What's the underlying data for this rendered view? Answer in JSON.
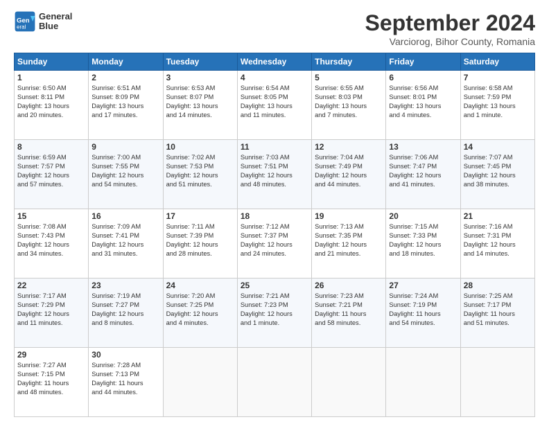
{
  "header": {
    "logo_line1": "General",
    "logo_line2": "Blue",
    "month_title": "September 2024",
    "location": "Varciorog, Bihor County, Romania"
  },
  "days_of_week": [
    "Sunday",
    "Monday",
    "Tuesday",
    "Wednesday",
    "Thursday",
    "Friday",
    "Saturday"
  ],
  "weeks": [
    [
      {
        "day": "1",
        "info": "Sunrise: 6:50 AM\nSunset: 8:11 PM\nDaylight: 13 hours\nand 20 minutes."
      },
      {
        "day": "2",
        "info": "Sunrise: 6:51 AM\nSunset: 8:09 PM\nDaylight: 13 hours\nand 17 minutes."
      },
      {
        "day": "3",
        "info": "Sunrise: 6:53 AM\nSunset: 8:07 PM\nDaylight: 13 hours\nand 14 minutes."
      },
      {
        "day": "4",
        "info": "Sunrise: 6:54 AM\nSunset: 8:05 PM\nDaylight: 13 hours\nand 11 minutes."
      },
      {
        "day": "5",
        "info": "Sunrise: 6:55 AM\nSunset: 8:03 PM\nDaylight: 13 hours\nand 7 minutes."
      },
      {
        "day": "6",
        "info": "Sunrise: 6:56 AM\nSunset: 8:01 PM\nDaylight: 13 hours\nand 4 minutes."
      },
      {
        "day": "7",
        "info": "Sunrise: 6:58 AM\nSunset: 7:59 PM\nDaylight: 13 hours\nand 1 minute."
      }
    ],
    [
      {
        "day": "8",
        "info": "Sunrise: 6:59 AM\nSunset: 7:57 PM\nDaylight: 12 hours\nand 57 minutes."
      },
      {
        "day": "9",
        "info": "Sunrise: 7:00 AM\nSunset: 7:55 PM\nDaylight: 12 hours\nand 54 minutes."
      },
      {
        "day": "10",
        "info": "Sunrise: 7:02 AM\nSunset: 7:53 PM\nDaylight: 12 hours\nand 51 minutes."
      },
      {
        "day": "11",
        "info": "Sunrise: 7:03 AM\nSunset: 7:51 PM\nDaylight: 12 hours\nand 48 minutes."
      },
      {
        "day": "12",
        "info": "Sunrise: 7:04 AM\nSunset: 7:49 PM\nDaylight: 12 hours\nand 44 minutes."
      },
      {
        "day": "13",
        "info": "Sunrise: 7:06 AM\nSunset: 7:47 PM\nDaylight: 12 hours\nand 41 minutes."
      },
      {
        "day": "14",
        "info": "Sunrise: 7:07 AM\nSunset: 7:45 PM\nDaylight: 12 hours\nand 38 minutes."
      }
    ],
    [
      {
        "day": "15",
        "info": "Sunrise: 7:08 AM\nSunset: 7:43 PM\nDaylight: 12 hours\nand 34 minutes."
      },
      {
        "day": "16",
        "info": "Sunrise: 7:09 AM\nSunset: 7:41 PM\nDaylight: 12 hours\nand 31 minutes."
      },
      {
        "day": "17",
        "info": "Sunrise: 7:11 AM\nSunset: 7:39 PM\nDaylight: 12 hours\nand 28 minutes."
      },
      {
        "day": "18",
        "info": "Sunrise: 7:12 AM\nSunset: 7:37 PM\nDaylight: 12 hours\nand 24 minutes."
      },
      {
        "day": "19",
        "info": "Sunrise: 7:13 AM\nSunset: 7:35 PM\nDaylight: 12 hours\nand 21 minutes."
      },
      {
        "day": "20",
        "info": "Sunrise: 7:15 AM\nSunset: 7:33 PM\nDaylight: 12 hours\nand 18 minutes."
      },
      {
        "day": "21",
        "info": "Sunrise: 7:16 AM\nSunset: 7:31 PM\nDaylight: 12 hours\nand 14 minutes."
      }
    ],
    [
      {
        "day": "22",
        "info": "Sunrise: 7:17 AM\nSunset: 7:29 PM\nDaylight: 12 hours\nand 11 minutes."
      },
      {
        "day": "23",
        "info": "Sunrise: 7:19 AM\nSunset: 7:27 PM\nDaylight: 12 hours\nand 8 minutes."
      },
      {
        "day": "24",
        "info": "Sunrise: 7:20 AM\nSunset: 7:25 PM\nDaylight: 12 hours\nand 4 minutes."
      },
      {
        "day": "25",
        "info": "Sunrise: 7:21 AM\nSunset: 7:23 PM\nDaylight: 12 hours\nand 1 minute."
      },
      {
        "day": "26",
        "info": "Sunrise: 7:23 AM\nSunset: 7:21 PM\nDaylight: 11 hours\nand 58 minutes."
      },
      {
        "day": "27",
        "info": "Sunrise: 7:24 AM\nSunset: 7:19 PM\nDaylight: 11 hours\nand 54 minutes."
      },
      {
        "day": "28",
        "info": "Sunrise: 7:25 AM\nSunset: 7:17 PM\nDaylight: 11 hours\nand 51 minutes."
      }
    ],
    [
      {
        "day": "29",
        "info": "Sunrise: 7:27 AM\nSunset: 7:15 PM\nDaylight: 11 hours\nand 48 minutes."
      },
      {
        "day": "30",
        "info": "Sunrise: 7:28 AM\nSunset: 7:13 PM\nDaylight: 11 hours\nand 44 minutes."
      },
      {
        "day": "",
        "info": ""
      },
      {
        "day": "",
        "info": ""
      },
      {
        "day": "",
        "info": ""
      },
      {
        "day": "",
        "info": ""
      },
      {
        "day": "",
        "info": ""
      }
    ]
  ]
}
